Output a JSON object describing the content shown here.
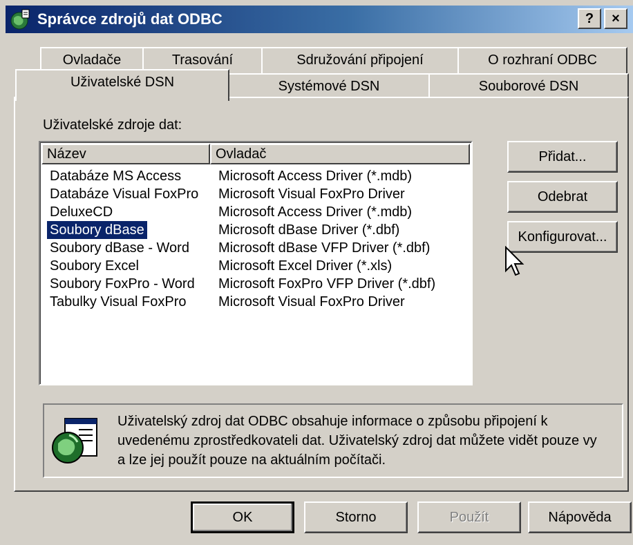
{
  "window": {
    "title": "Správce zdrojů dat ODBC",
    "help_button": "?",
    "close_button": "×"
  },
  "tabs": {
    "row_back": [
      "Ovladače",
      "Trasování",
      "Sdružování připojení",
      "O rozhraní ODBC"
    ],
    "row_front": [
      "Uživatelské DSN",
      "Systémové DSN",
      "Souborové DSN"
    ],
    "active": "Uživatelské DSN"
  },
  "group_label": "Uživatelské zdroje dat:",
  "list": {
    "columns": [
      "Název",
      "Ovladač"
    ],
    "rows": [
      {
        "name": "Databáze MS Access",
        "driver": "Microsoft Access Driver (*.mdb)"
      },
      {
        "name": "Databáze Visual FoxPro",
        "driver": "Microsoft Visual FoxPro Driver"
      },
      {
        "name": "DeluxeCD",
        "driver": "Microsoft Access Driver (*.mdb)"
      },
      {
        "name": "Soubory dBase",
        "driver": "Microsoft dBase Driver (*.dbf)"
      },
      {
        "name": "Soubory dBase - Word",
        "driver": "Microsoft dBase VFP Driver (*.dbf)"
      },
      {
        "name": "Soubory Excel",
        "driver": "Microsoft Excel Driver (*.xls)"
      },
      {
        "name": "Soubory FoxPro - Word",
        "driver": "Microsoft FoxPro VFP Driver (*.dbf)"
      },
      {
        "name": "Tabulky Visual FoxPro",
        "driver": "Microsoft Visual FoxPro Driver"
      }
    ],
    "selected": "Soubory dBase"
  },
  "side_buttons": {
    "add": "Přidat...",
    "remove": "Odebrat",
    "configure": "Konfigurovat..."
  },
  "info_text": "Uživatelský zdroj dat ODBC obsahuje informace o způsobu připojení k uvedenému zprostředkovateli dat. Uživatelský zdroj dat můžete vidět pouze vy a lze jej použít pouze na aktuálním počítači.",
  "bottom_buttons": {
    "ok": "OK",
    "cancel": "Storno",
    "apply": "Použít",
    "help": "Nápověda"
  },
  "colors": {
    "face": "#d4d0c8",
    "title_start": "#0a246a",
    "title_end": "#a6caf0",
    "selection": "#0a246a"
  },
  "icons": [
    "odbc-globe-icon",
    "help-icon",
    "close-icon",
    "info-globe-icon",
    "mouse-cursor-icon"
  ]
}
